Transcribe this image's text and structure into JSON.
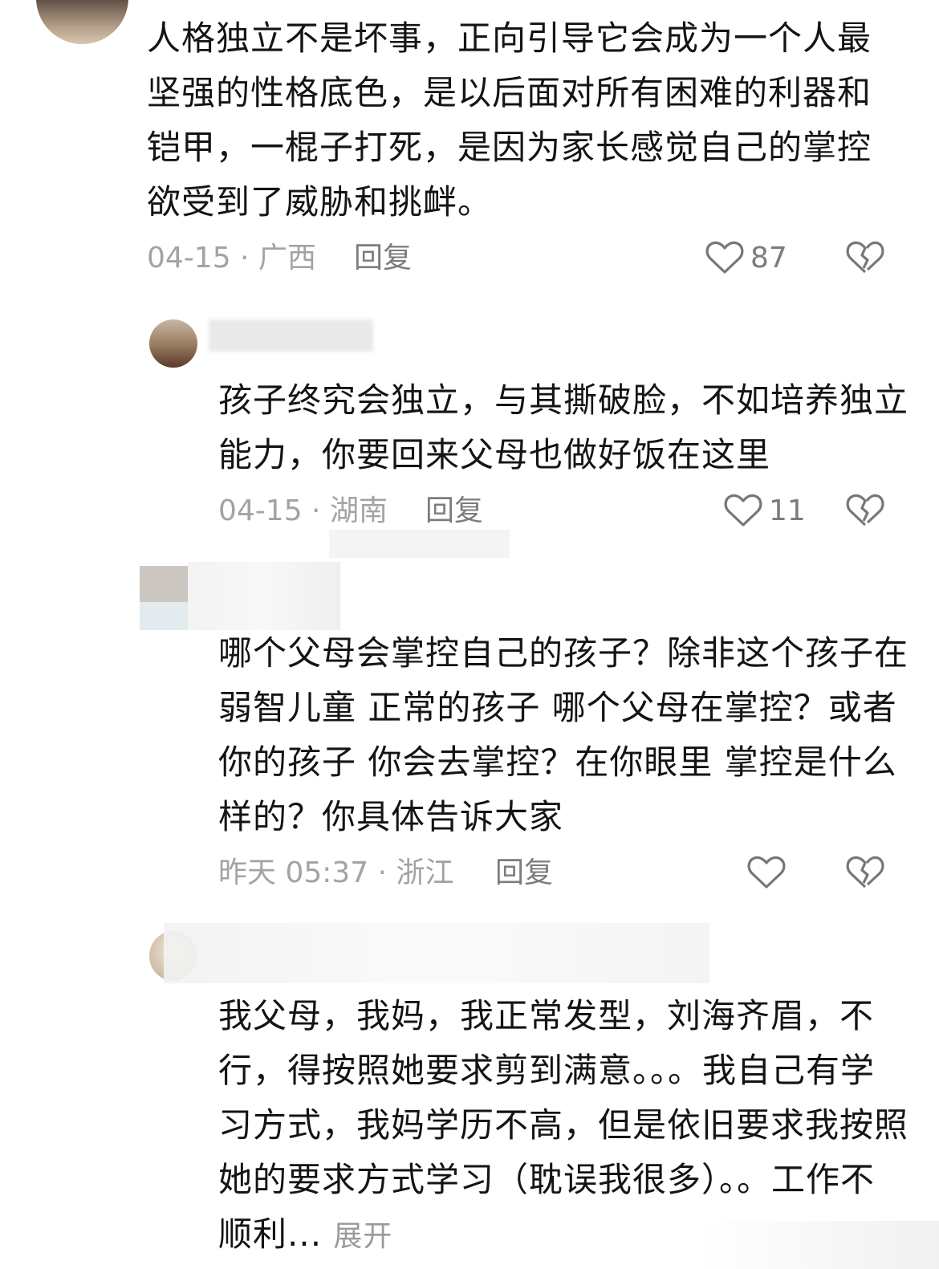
{
  "comments": [
    {
      "text": "人格独立不是坏事，正向引导它会成为一个人最坚强的性格底色，是以后面对所有困难的利器和铠甲，一棍子打死，是因为家长感觉自己的掌控欲受到了威胁和挑衅。",
      "meta": "04-15 · 广西",
      "reply": "回复",
      "likes": "87"
    },
    {
      "text": "孩子终究会独立，与其撕破脸，不如培养独立能力，你要回来父母也做好饭在这里",
      "meta": "04-15 · 湖南",
      "reply": "回复",
      "likes": "11"
    },
    {
      "text": "哪个父母会掌控自己的孩子？除非这个孩子在弱智儿童 正常的孩子 哪个父母在掌控？或者你的孩子 你会去掌控？在你眼里 掌控是什么样的？你具体告诉大家",
      "meta": "昨天 05:37 · 浙江",
      "reply": "回复",
      "likes": ""
    },
    {
      "text": "我父母，我妈，我正常发型，刘海齐眉，不行，得按照她要求剪到满意。。。我自己有学习方式，我妈学历不高，但是依旧要求我按照她的要求方式学习（耽误我很多）。。工作不顺利...",
      "more": "展开"
    }
  ],
  "icons": {
    "like": "heart-outline-icon",
    "dislike": "broken-heart-icon"
  },
  "colors": {
    "text": "#141414",
    "meta": "#a3a3a3",
    "secondary": "#7c7c7c"
  }
}
